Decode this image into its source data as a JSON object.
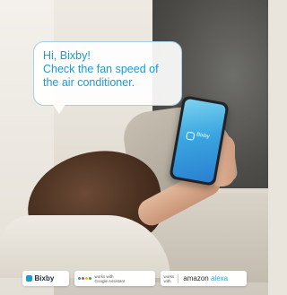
{
  "bubble": {
    "lines": [
      "Hi, Bixby!",
      "Check the fan speed of",
      "the air conditioner."
    ]
  },
  "phone": {
    "screen_label": "Bixby"
  },
  "logos": {
    "bixby": "Bixby",
    "google_line1": "works with",
    "google_line2": "Google Assistant",
    "alexa_line1": "works",
    "alexa_line2": "with",
    "alexa_brand": "amazon",
    "alexa_name": "alexa"
  },
  "colors": {
    "bubble_text": "#1a9ad6",
    "bubble_border": "#a8cfe2",
    "phone_screen": "#3aa6e0"
  }
}
